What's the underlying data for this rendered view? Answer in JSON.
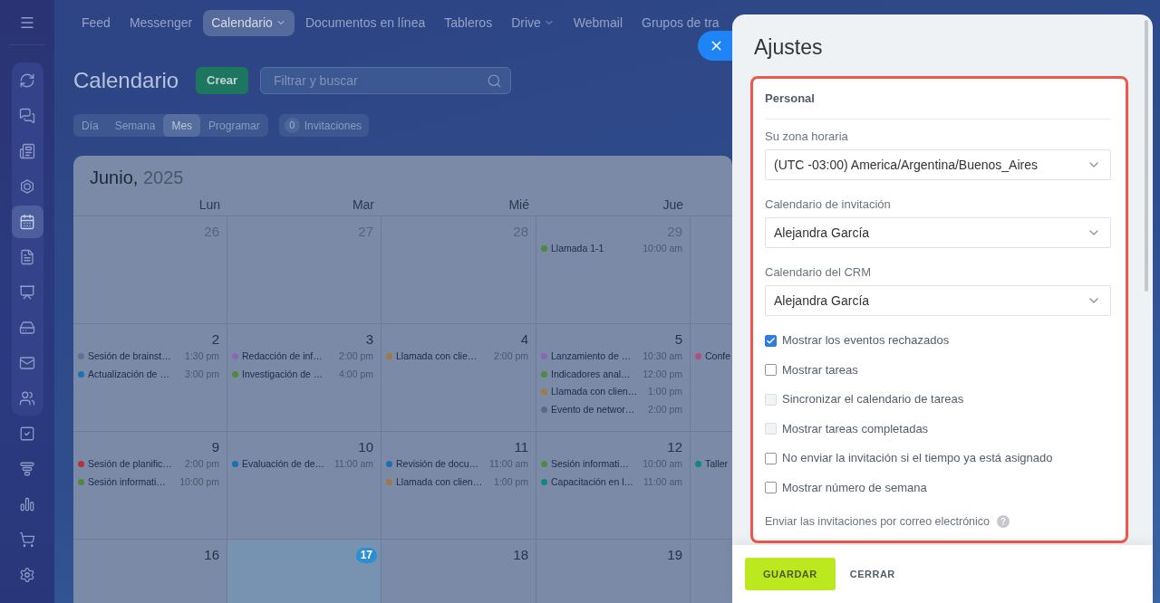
{
  "sidebar": {
    "items": [
      {
        "selected": false
      },
      {
        "selected": false
      },
      {
        "selected": false
      },
      {
        "selected": false
      },
      {
        "selected": true
      },
      {
        "selected": false
      },
      {
        "selected": false
      },
      {
        "selected": false
      },
      {
        "selected": false
      },
      {
        "selected": false
      },
      {
        "selected": false
      },
      {
        "selected": false
      },
      {
        "selected": false
      },
      {
        "selected": false
      },
      {
        "selected": false
      }
    ]
  },
  "top_nav": {
    "items": [
      {
        "label": "Feed",
        "selected": false,
        "has_menu": false
      },
      {
        "label": "Messenger",
        "selected": false,
        "has_menu": false
      },
      {
        "label": "Calendario",
        "selected": true,
        "has_menu": true
      },
      {
        "label": "Documentos en línea",
        "selected": false,
        "has_menu": false
      },
      {
        "label": "Tableros",
        "selected": false,
        "has_menu": false
      },
      {
        "label": "Drive",
        "selected": false,
        "has_menu": true
      },
      {
        "label": "Webmail",
        "selected": false,
        "has_menu": false
      },
      {
        "label": "Grupos de tra",
        "selected": false,
        "has_menu": false
      }
    ]
  },
  "page": {
    "title": "Calendario",
    "create_button": "Crear",
    "search": {
      "placeholder": "Filtrar y buscar"
    },
    "view_tabs": [
      {
        "label": "Día",
        "selected": false
      },
      {
        "label": "Semana",
        "selected": false
      },
      {
        "label": "Mes",
        "selected": true
      },
      {
        "label": "Programar",
        "selected": false
      }
    ],
    "invitations": {
      "count": "0",
      "label": "Invitaciones"
    }
  },
  "calendar": {
    "month": "Junio,",
    "year": "2025",
    "weekdays": [
      "Lun",
      "Mar",
      "Mié",
      "Jue"
    ],
    "weeks": [
      {
        "days": [
          {
            "day": "26",
            "outside_month": true,
            "today": false
          },
          {
            "day": "27",
            "outside_month": true,
            "today": false
          },
          {
            "day": "28",
            "outside_month": true,
            "today": false
          },
          {
            "day": "29",
            "outside_month": true,
            "today": false,
            "events": [
              {
                "title": "Llamada 1-1",
                "time": "10:00 am",
                "color": "#4f8a3c"
              }
            ]
          }
        ]
      },
      {
        "days": [
          {
            "day": "2",
            "outside_month": false,
            "today": false,
            "events": [
              {
                "title": "Sesión de brainst…",
                "time": "1:30 pm",
                "color": "#5f7090"
              },
              {
                "title": "Actualización de …",
                "time": "3:00 pm",
                "color": "#1e6fb0"
              }
            ]
          },
          {
            "day": "3",
            "outside_month": false,
            "today": false,
            "events": [
              {
                "title": "Redacción de inf…",
                "time": "2:00 pm",
                "color": "#8a66b4"
              },
              {
                "title": "Investigación de …",
                "time": "4:00 pm",
                "color": "#4f8a3c"
              }
            ]
          },
          {
            "day": "4",
            "outside_month": false,
            "today": false,
            "events": [
              {
                "title": "Llamada con clie…",
                "time": "2:00 pm",
                "color": "#a07a45"
              }
            ]
          },
          {
            "day": "5",
            "outside_month": false,
            "today": false,
            "events": [
              {
                "title": "Lanzamiento de …",
                "time": "10:30 am",
                "color": "#8a66b4"
              },
              {
                "title": "Indicadores anal…",
                "time": "12:00 pm",
                "color": "#4f8a3c"
              },
              {
                "title": "Llamada con clien…",
                "time": "1:00 pm",
                "color": "#a07a45"
              },
              {
                "title": "Evento de networ…",
                "time": "2:00 pm",
                "color": "#586a8a"
              }
            ]
          },
          {
            "events": [
              {
                "title": "Confe",
                "color": "#b0507f"
              }
            ]
          }
        ]
      },
      {
        "days": [
          {
            "day": "9",
            "outside_month": false,
            "today": false,
            "events": [
              {
                "title": "Sesión de planific…",
                "time": "2:00 pm",
                "color": "#b3303f"
              },
              {
                "title": "Sesión informati…",
                "time": "10:00 pm",
                "color": "#4f8a3c"
              }
            ]
          },
          {
            "day": "10",
            "outside_month": false,
            "today": false,
            "events": [
              {
                "title": "Evaluación de de…",
                "time": "11:00 am",
                "color": "#1e6fb0"
              }
            ]
          },
          {
            "day": "11",
            "outside_month": false,
            "today": false,
            "events": [
              {
                "title": "Revisión de docu…",
                "time": "11:00 am",
                "color": "#1e6fb0"
              },
              {
                "title": "Llamada con clien…",
                "time": "1:00 pm",
                "color": "#a07a45"
              }
            ]
          },
          {
            "day": "12",
            "outside_month": false,
            "today": false,
            "events": [
              {
                "title": "Sesión informati…",
                "time": "10:00 am",
                "color": "#4f8a3c"
              },
              {
                "title": "Capacitación en l…",
                "time": "11:00 am",
                "color": "#11887a"
              }
            ]
          },
          {
            "events": [
              {
                "title": "Taller",
                "color": "#11887a"
              }
            ]
          }
        ]
      },
      {
        "days": [
          {
            "day": "16",
            "outside_month": false,
            "today": false
          },
          {
            "day": "17",
            "outside_month": false,
            "today": true
          },
          {
            "day": "18",
            "outside_month": false,
            "today": false
          },
          {
            "day": "19",
            "outside_month": false,
            "today": false
          }
        ]
      }
    ]
  },
  "settings_panel": {
    "title": "Ajustes",
    "section": {
      "highlighted": true,
      "title": "Personal",
      "selects": [
        {
          "label": "Su zona horaria",
          "value": "(UTC -03:00) America/Argentina/Buenos_Aires"
        },
        {
          "label": "Calendario de invitación",
          "value": "Alejandra García"
        },
        {
          "label": "Calendario del CRM",
          "value": "Alejandra García"
        }
      ],
      "checkboxes": [
        {
          "label": "Mostrar los eventos rechazados",
          "checked": true,
          "disabled": false
        },
        {
          "label": "Mostrar tareas",
          "checked": false,
          "disabled": false
        },
        {
          "label": "Sincronizar el calendario de tareas",
          "checked": false,
          "disabled": true
        },
        {
          "label": "Mostrar tareas completadas",
          "checked": false,
          "disabled": true
        },
        {
          "label": "No enviar la invitación si el tiempo ya está asignado",
          "checked": false,
          "disabled": false
        },
        {
          "label": "Mostrar número de semana",
          "checked": false,
          "disabled": false
        }
      ],
      "email_invitations_label": "Enviar las invitaciones por correo electrónico"
    },
    "buttons": [
      {
        "label": "GUARDAR",
        "kind": "primary"
      },
      {
        "label": "CERRAR",
        "kind": "link"
      }
    ]
  }
}
